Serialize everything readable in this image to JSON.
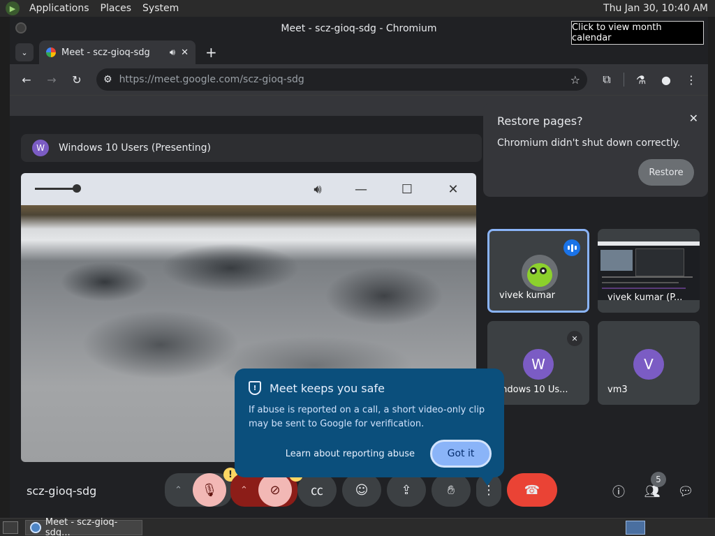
{
  "top_panel": {
    "menus": [
      "Applications",
      "Places",
      "System"
    ],
    "clock": "Thu Jan 30, 10:40 AM",
    "clock_tooltip": "Click to view month calendar"
  },
  "window": {
    "title": "Meet - scz-gioq-sdg - Chromium",
    "tab": {
      "title": "Meet - scz-gioq-sdg",
      "audio_icon": "speaker-icon"
    },
    "url_host": "https://meet.google.com",
    "url_path": "/scz-gioq-sdg"
  },
  "restore_popup": {
    "title": "Restore pages?",
    "message": "Chromium didn't shut down correctly.",
    "button": "Restore"
  },
  "meet": {
    "presenter": {
      "initial": "W",
      "label": "Windows 10 Users (Presenting)"
    },
    "safety_card": {
      "title": "Meet keeps you safe",
      "body": "If abuse is reported on a call, a short video-only clip may be sent to Google for verification.",
      "link": "Learn about reporting abuse",
      "button": "Got it"
    },
    "tiles": [
      {
        "name": "vivek kumar",
        "speaking": true
      },
      {
        "name": "vivek kumar (P...",
        "presenting": true
      },
      {
        "name": "Windows 10 Us...",
        "initial": "W",
        "muted": true
      },
      {
        "name": "vm3",
        "initial": "V"
      }
    ],
    "meeting_code": "scz-gioq-sdg",
    "participants_count": "5",
    "colors": {
      "accent": "#8ab4f8",
      "end_call": "#ea4335",
      "card": "#0b4f7c",
      "avatar": "#7b5cc4"
    }
  },
  "taskbar": {
    "item": "Meet - scz-gioq-sdg..."
  }
}
